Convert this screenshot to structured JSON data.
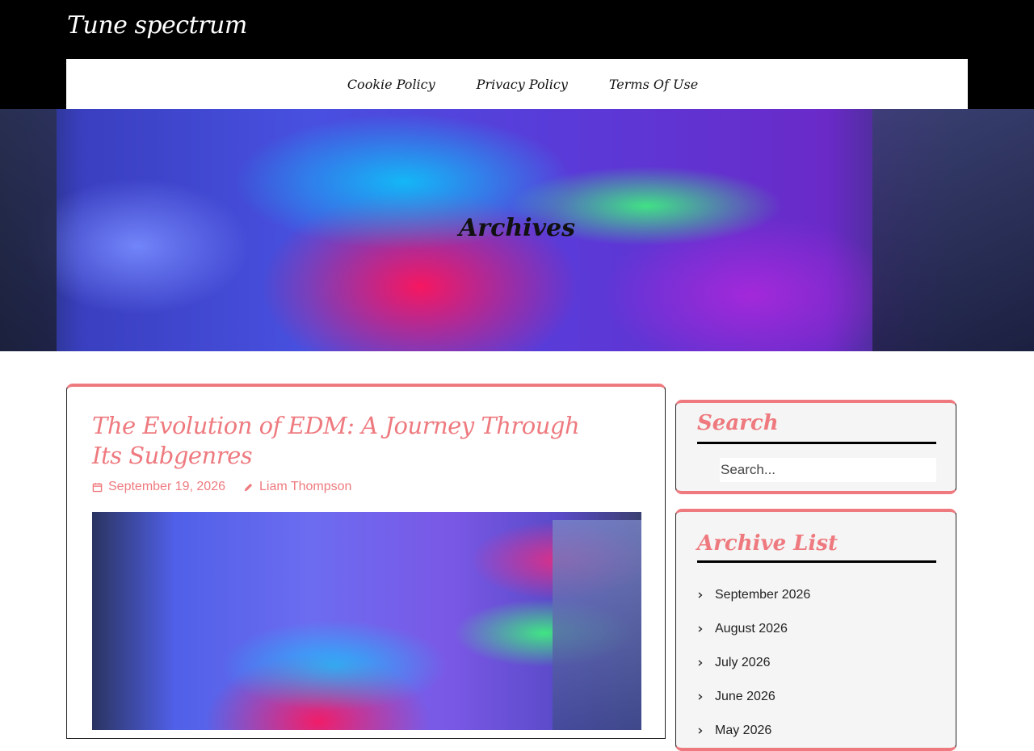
{
  "site": {
    "title": "Tune spectrum"
  },
  "nav": {
    "items": [
      {
        "label": "Cookie Policy"
      },
      {
        "label": "Privacy Policy"
      },
      {
        "label": "Terms Of Use"
      }
    ]
  },
  "hero": {
    "title": "Archives"
  },
  "post": {
    "title": "The Evolution of EDM: A Journey Through Its Subgenres",
    "date": "September 19, 2026",
    "author": "Liam Thompson",
    "date_icon": "calendar-icon",
    "author_icon": "pencil-icon"
  },
  "sidebar": {
    "search": {
      "title": "Search",
      "placeholder": "Search..."
    },
    "archive": {
      "title": "Archive List",
      "items": [
        "September 2026",
        "August 2026",
        "July 2026",
        "June 2026",
        "May 2026"
      ]
    }
  },
  "colors": {
    "accent": "#ee7a7f",
    "header_bg": "#000000"
  }
}
